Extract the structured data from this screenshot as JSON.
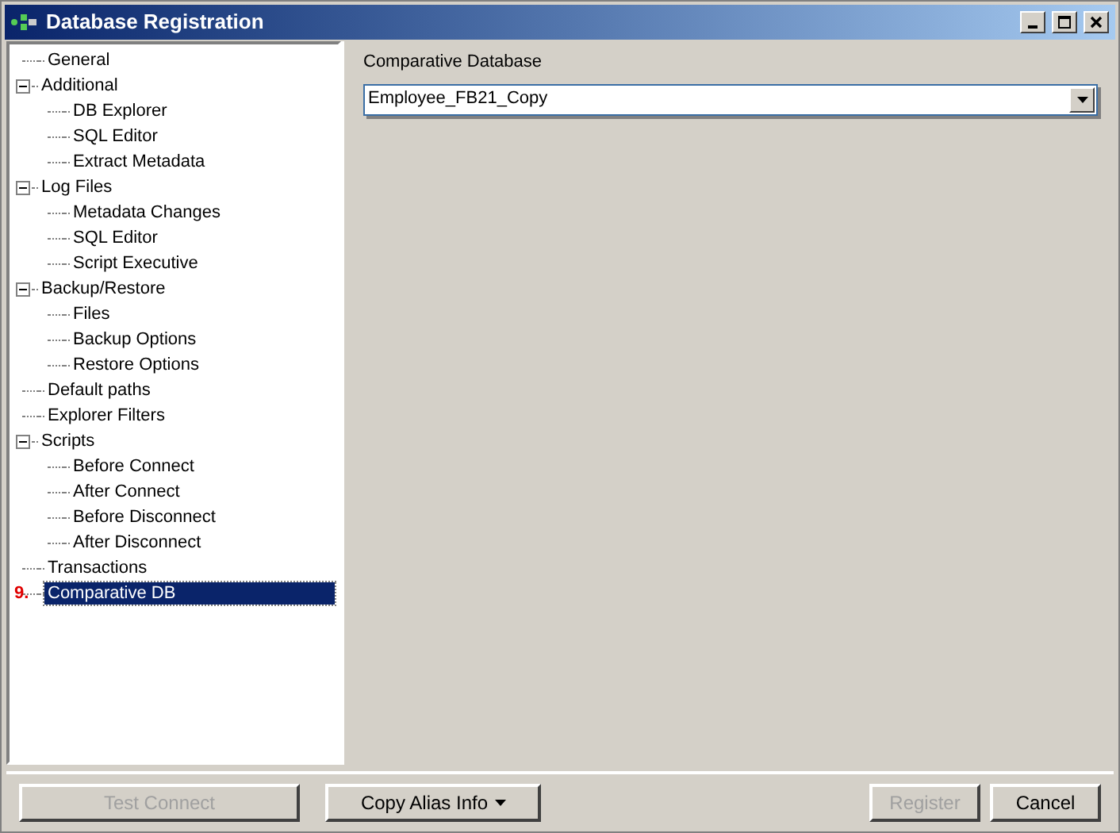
{
  "window": {
    "title": "Database Registration"
  },
  "tree": [
    {
      "label": "General",
      "selected": false
    },
    {
      "label": "Additional",
      "selected": false,
      "expanded": true,
      "children": [
        {
          "label": "DB Explorer",
          "selected": false
        },
        {
          "label": "SQL Editor",
          "selected": false
        },
        {
          "label": "Extract Metadata",
          "selected": false
        }
      ]
    },
    {
      "label": "Log Files",
      "selected": false,
      "expanded": true,
      "children": [
        {
          "label": "Metadata Changes",
          "selected": false
        },
        {
          "label": "SQL Editor",
          "selected": false
        },
        {
          "label": "Script Executive",
          "selected": false
        }
      ]
    },
    {
      "label": "Backup/Restore",
      "selected": false,
      "expanded": true,
      "children": [
        {
          "label": "Files",
          "selected": false
        },
        {
          "label": "Backup Options",
          "selected": false
        },
        {
          "label": "Restore Options",
          "selected": false
        }
      ]
    },
    {
      "label": "Default paths",
      "selected": false
    },
    {
      "label": "Explorer Filters",
      "selected": false
    },
    {
      "label": "Scripts",
      "selected": false,
      "expanded": true,
      "children": [
        {
          "label": "Before Connect",
          "selected": false
        },
        {
          "label": "After Connect",
          "selected": false
        },
        {
          "label": "Before Disconnect",
          "selected": false
        },
        {
          "label": "After Disconnect",
          "selected": false
        }
      ]
    },
    {
      "label": "Transactions",
      "selected": false
    },
    {
      "label": "Comparative DB",
      "selected": true,
      "marker": "9."
    }
  ],
  "panel": {
    "label": "Comparative Database",
    "value": "Employee_FB21_Copy"
  },
  "buttons": [
    {
      "label": "Test Connect",
      "disabled": true,
      "kind": "plain"
    },
    {
      "label": "Copy Alias Info",
      "disabled": false,
      "kind": "menu"
    },
    {
      "label": "Register",
      "disabled": true,
      "kind": "plain"
    },
    {
      "label": "Cancel",
      "disabled": false,
      "kind": "plain"
    }
  ]
}
